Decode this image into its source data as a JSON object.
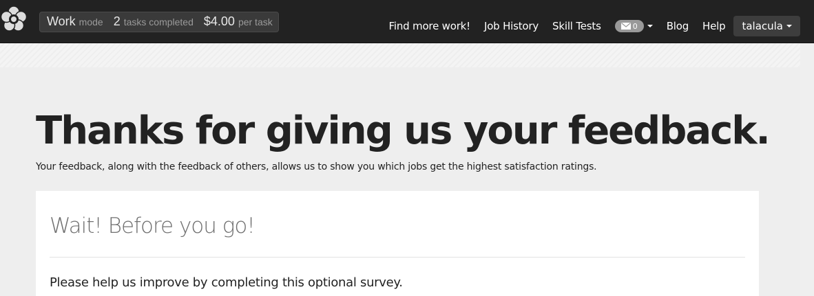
{
  "navbar": {
    "stats": {
      "mode_value": "Work",
      "mode_label": "mode",
      "tasks_value": "2",
      "tasks_label": "tasks completed",
      "pay_value": "$4.00",
      "pay_label": "per task"
    },
    "links": {
      "find_work": "Find more work!",
      "job_history": "Job History",
      "skill_tests": "Skill Tests",
      "blog": "Blog",
      "help": "Help"
    },
    "messages": {
      "count": "0",
      "icon": "envelope-icon"
    },
    "user": {
      "name": "talacula"
    },
    "logo_icon": "flower-logo-icon"
  },
  "main": {
    "headline": "Thanks for giving us your feedback.",
    "subline": "Your feedback, along with the feedback of others, allows us to show you which jobs get the highest satisfaction ratings.",
    "card": {
      "title": "Wait! Before you go!",
      "text": "Please help us improve by completing this optional survey."
    }
  },
  "colors": {
    "navbar_bg": "#222222",
    "panel_bg": "#eeeeee",
    "card_bg": "#ffffff",
    "badge_bg": "#999999"
  }
}
